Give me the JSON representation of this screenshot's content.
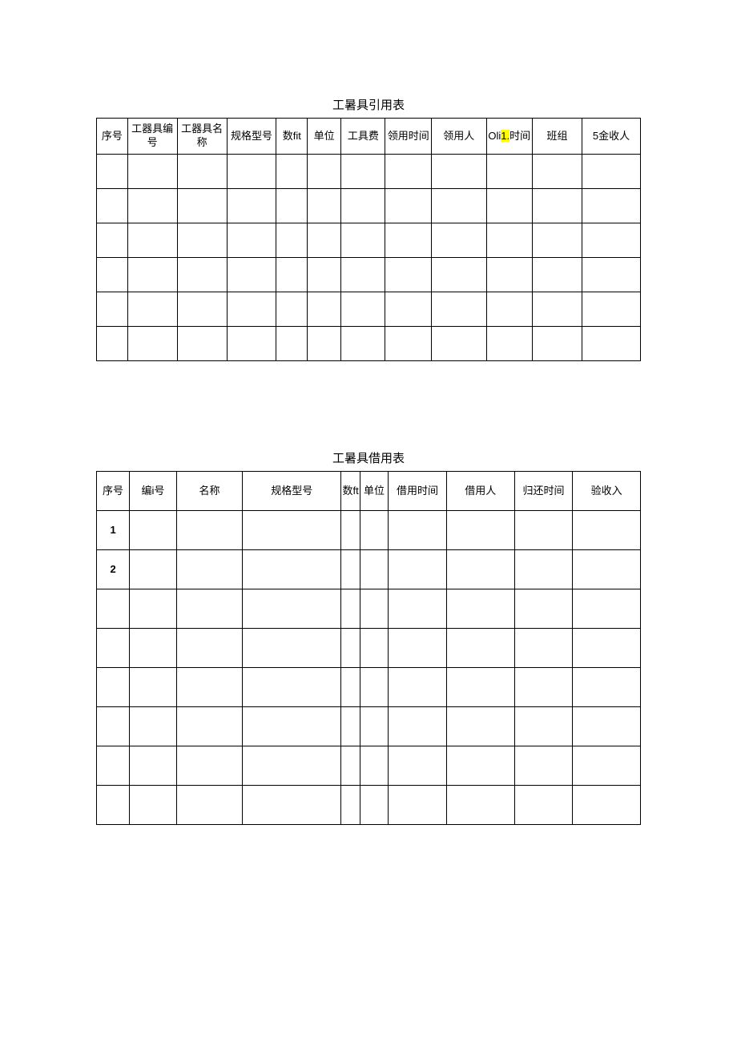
{
  "table1": {
    "title": "工暑具引用表",
    "headers": {
      "c1": "序号",
      "c2": "工器具编号",
      "c3": "工器具名称",
      "c4": "规格型号",
      "c5": "数fit",
      "c6": "单位",
      "c7": "工具费",
      "c8": "领用时间",
      "c9": "领用人",
      "c10_pre": "Oli",
      "c10_hl": "1.",
      "c10_post": "时间",
      "c11": "班组",
      "c12": "5金收人"
    },
    "rows": 6
  },
  "table2": {
    "title": "工暑具借用表",
    "headers": {
      "c1": "序号",
      "c2": "编i号",
      "c3": "名称",
      "c4": "规格型号",
      "c5": "数ft",
      "c6": "单位",
      "c7": "借用时间",
      "c8": "借用人",
      "c9": "归还时间",
      "c10": "验收入"
    },
    "rows_numbered": [
      "1",
      "2"
    ],
    "rows_blank": 6
  }
}
